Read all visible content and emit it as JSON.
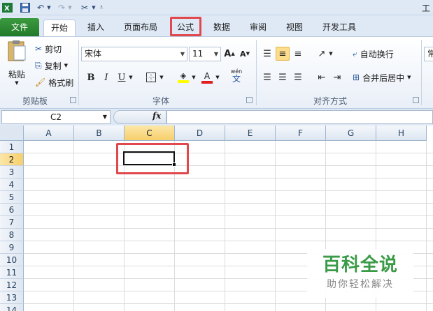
{
  "qat": {
    "title_fragment": "工"
  },
  "tabs": [
    {
      "label": "文件"
    },
    {
      "label": "开始"
    },
    {
      "label": "插入"
    },
    {
      "label": "页面布局"
    },
    {
      "label": "公式"
    },
    {
      "label": "数据"
    },
    {
      "label": "审阅"
    },
    {
      "label": "视图"
    },
    {
      "label": "开发工具"
    }
  ],
  "clipboard": {
    "paste": "粘贴",
    "cut": "剪切",
    "copy": "复制",
    "format_painter": "格式刷",
    "group": "剪贴板"
  },
  "font": {
    "name": "宋体",
    "size": "11",
    "group": "字体",
    "phonetic": "wén"
  },
  "alignment": {
    "wrap": "自动换行",
    "merge": "合并后居中",
    "group": "对齐方式",
    "number_fragment": "常"
  },
  "formula_bar": {
    "name_box": "C2",
    "fx": "fx"
  },
  "grid": {
    "columns": [
      "A",
      "B",
      "C",
      "D",
      "E",
      "F",
      "G",
      "H"
    ],
    "rows": [
      "1",
      "2",
      "3",
      "4",
      "5",
      "6",
      "7",
      "8",
      "9",
      "10",
      "11",
      "12",
      "13",
      "14"
    ],
    "selected_cell": "C2"
  },
  "watermark": {
    "title": "百科全说",
    "subtitle": "助你轻松解决"
  },
  "colors": {
    "highlight": "#e0484d",
    "file_tab": "#217a2a",
    "selected_header": "#f7cf6a",
    "watermark_green": "#3a9b47"
  }
}
